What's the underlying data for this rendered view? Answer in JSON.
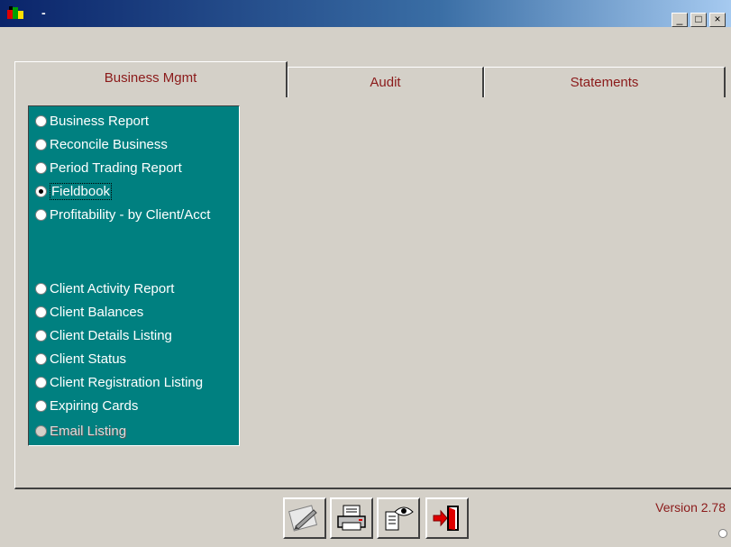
{
  "window": {
    "title": "-",
    "controls": [
      "_",
      "□",
      "×"
    ]
  },
  "tabs": [
    {
      "label": "Business Mgmt",
      "active": true
    },
    {
      "label": "Audit",
      "active": false
    },
    {
      "label": "Statements",
      "active": false
    }
  ],
  "options": [
    {
      "label": "Business Report",
      "checked": false
    },
    {
      "label": "Reconcile Business",
      "checked": false
    },
    {
      "label": "Period Trading Report",
      "checked": false
    },
    {
      "label": "Fieldbook",
      "checked": true
    },
    {
      "label": "Profitability - by Client/Acct",
      "checked": false
    },
    {
      "label": "Client Activity Report",
      "checked": false
    },
    {
      "label": "Client Balances",
      "checked": false
    },
    {
      "label": "Client Details Listing",
      "checked": false
    },
    {
      "label": "Client Status",
      "checked": false
    },
    {
      "label": "Client Registration Listing",
      "checked": false
    },
    {
      "label": "Expiring Cards",
      "checked": false
    },
    {
      "label": "Email Listing",
      "checked": false,
      "disabled": true
    }
  ],
  "toolbar": {
    "icons": [
      "edit-pencil-icon",
      "printer-icon",
      "preview-eye-icon",
      "exit-door-icon"
    ]
  },
  "footer": {
    "version": "Version 2.78"
  },
  "colors": {
    "title_gradient_start": "#0a246a",
    "panel_bg": "#008080",
    "tab_text": "#8b1a1a",
    "version_text": "#8b1a1a"
  }
}
